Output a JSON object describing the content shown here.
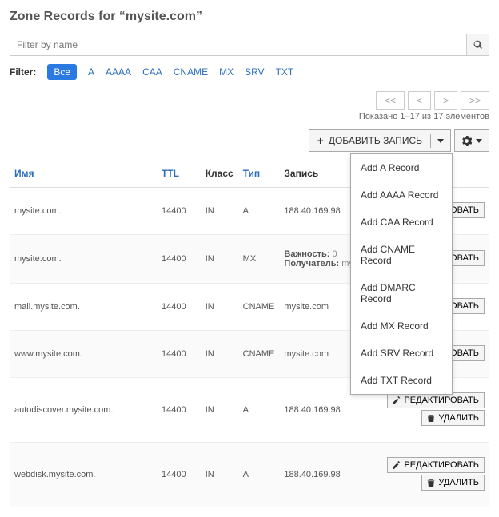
{
  "title": "Zone Records for “mysite.com”",
  "filter_placeholder": "Filter by name",
  "filters_label": "Filter:",
  "filter_tags": [
    "Все",
    "A",
    "AAAA",
    "CAA",
    "CNAME",
    "MX",
    "SRV",
    "TXT"
  ],
  "pager": {
    "first": "<<",
    "prev": "<",
    "next": ">",
    "last": ">>",
    "info": "Показано 1–17 из 17 элементов"
  },
  "toolbar": {
    "add_label": "ДОБАВИТЬ ЗАПИСЬ"
  },
  "dropdown": [
    "Add A Record",
    "Add AAAA Record",
    "Add CAA Record",
    "Add CNAME Record",
    "Add DMARC Record",
    "Add MX Record",
    "Add SRV Record",
    "Add TXT Record"
  ],
  "columns": {
    "name": "Имя",
    "ttl": "TTL",
    "class": "Класс",
    "type": "Тип",
    "record": "Запись"
  },
  "actions": {
    "edit": "РЕДАКТИРОВАТЬ",
    "delete": "УДАЛИТЬ"
  },
  "mx_labels": {
    "priority": "Важность:",
    "recipient": "Получатель:"
  },
  "rows": [
    {
      "name": "mysite.com.",
      "ttl": "14400",
      "class": "IN",
      "type": "A",
      "record": "188.40.169.98"
    },
    {
      "name": "mysite.com.",
      "ttl": "14400",
      "class": "IN",
      "type": "MX",
      "record": "",
      "mx_priority": "0",
      "mx_recipient": "mysite"
    },
    {
      "name": "mail.mysite.com.",
      "ttl": "14400",
      "class": "IN",
      "type": "CNAME",
      "record": "mysite.com"
    },
    {
      "name": "www.mysite.com.",
      "ttl": "14400",
      "class": "IN",
      "type": "CNAME",
      "record": "mysite.com"
    },
    {
      "name": "autodiscover.mysite.com.",
      "ttl": "14400",
      "class": "IN",
      "type": "A",
      "record": "188.40.169.98"
    },
    {
      "name": "webdisk.mysite.com.",
      "ttl": "14400",
      "class": "IN",
      "type": "A",
      "record": "188.40.169.98"
    }
  ]
}
